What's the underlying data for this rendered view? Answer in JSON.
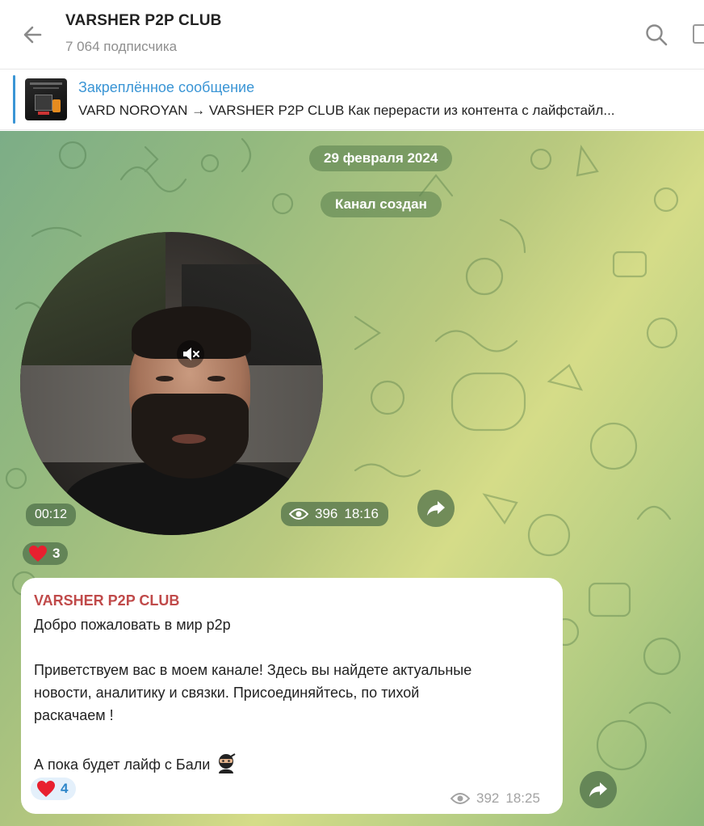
{
  "header": {
    "channel_title": "VARSHER P2P CLUB",
    "subscribers": "7 064 подписчика"
  },
  "pinned": {
    "label": "Закреплённое сообщение",
    "text": "VARD NOROYAN → VARSHER P2P CLUB  Как перерасти из контента с лайфстайл..."
  },
  "chat": {
    "date_pill": "29 февраля 2024",
    "service_pill": "Канал создан",
    "video_message": {
      "duration": "00:12",
      "views": "396",
      "time": "18:16",
      "reaction": {
        "emoji": "❤️",
        "count": "3"
      }
    },
    "text_message": {
      "author": "VARSHER P2P CLUB",
      "line1": "Добро пожаловать в мир p2p",
      "line2": "Приветствуем вас в моем канале! Здесь вы найдете актуальные",
      "line3": "новости, аналитику и связки. Присоединяйтесь, по тихой",
      "line4": "раскачаем !",
      "line5": "А пока будет лайф с Бали",
      "views": "392",
      "time": "18:25",
      "reaction": {
        "emoji": "❤️",
        "count": "4"
      }
    }
  },
  "colors": {
    "accent": "#3a95d5",
    "author": "#c04a4a",
    "heart": "#e8202f"
  },
  "icons": [
    "back-arrow-icon",
    "search-icon",
    "more-icon",
    "mute-icon",
    "eye-icon",
    "forward-icon",
    "heart-icon",
    "ninja-emoji-icon"
  ]
}
